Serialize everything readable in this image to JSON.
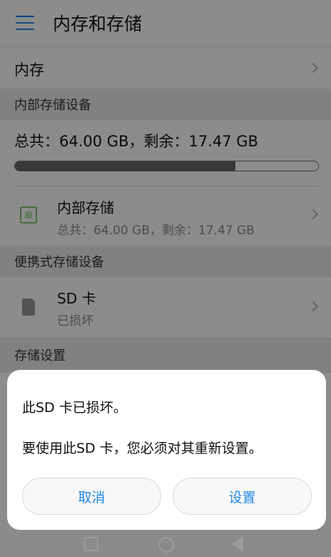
{
  "appbar": {
    "title": "内存和存储"
  },
  "memory_row": {
    "label": "内存"
  },
  "internal_section": {
    "header": "内部存储设备",
    "summary": "总共：64.00 GB，剩余：17.47 GB",
    "used_fraction": 0.727,
    "item": {
      "label": "内部存储",
      "sub": "总共：64.00 GB，剩余：17.47 GB",
      "icon": "chip-icon"
    }
  },
  "portable_section": {
    "header": "便携式存储设备",
    "item": {
      "label": "SD 卡",
      "sub": "已损坏",
      "icon": "sd-card-icon"
    }
  },
  "storage_settings": {
    "header": "存储设置"
  },
  "dialog": {
    "line1": "此SD 卡已损坏。",
    "line2": "要使用此SD 卡，您必须对其重新设置。",
    "cancel_label": "取消",
    "setup_label": "设置"
  },
  "colors": {
    "accent": "#1e88e5",
    "chip_green": "#7cc56b"
  }
}
